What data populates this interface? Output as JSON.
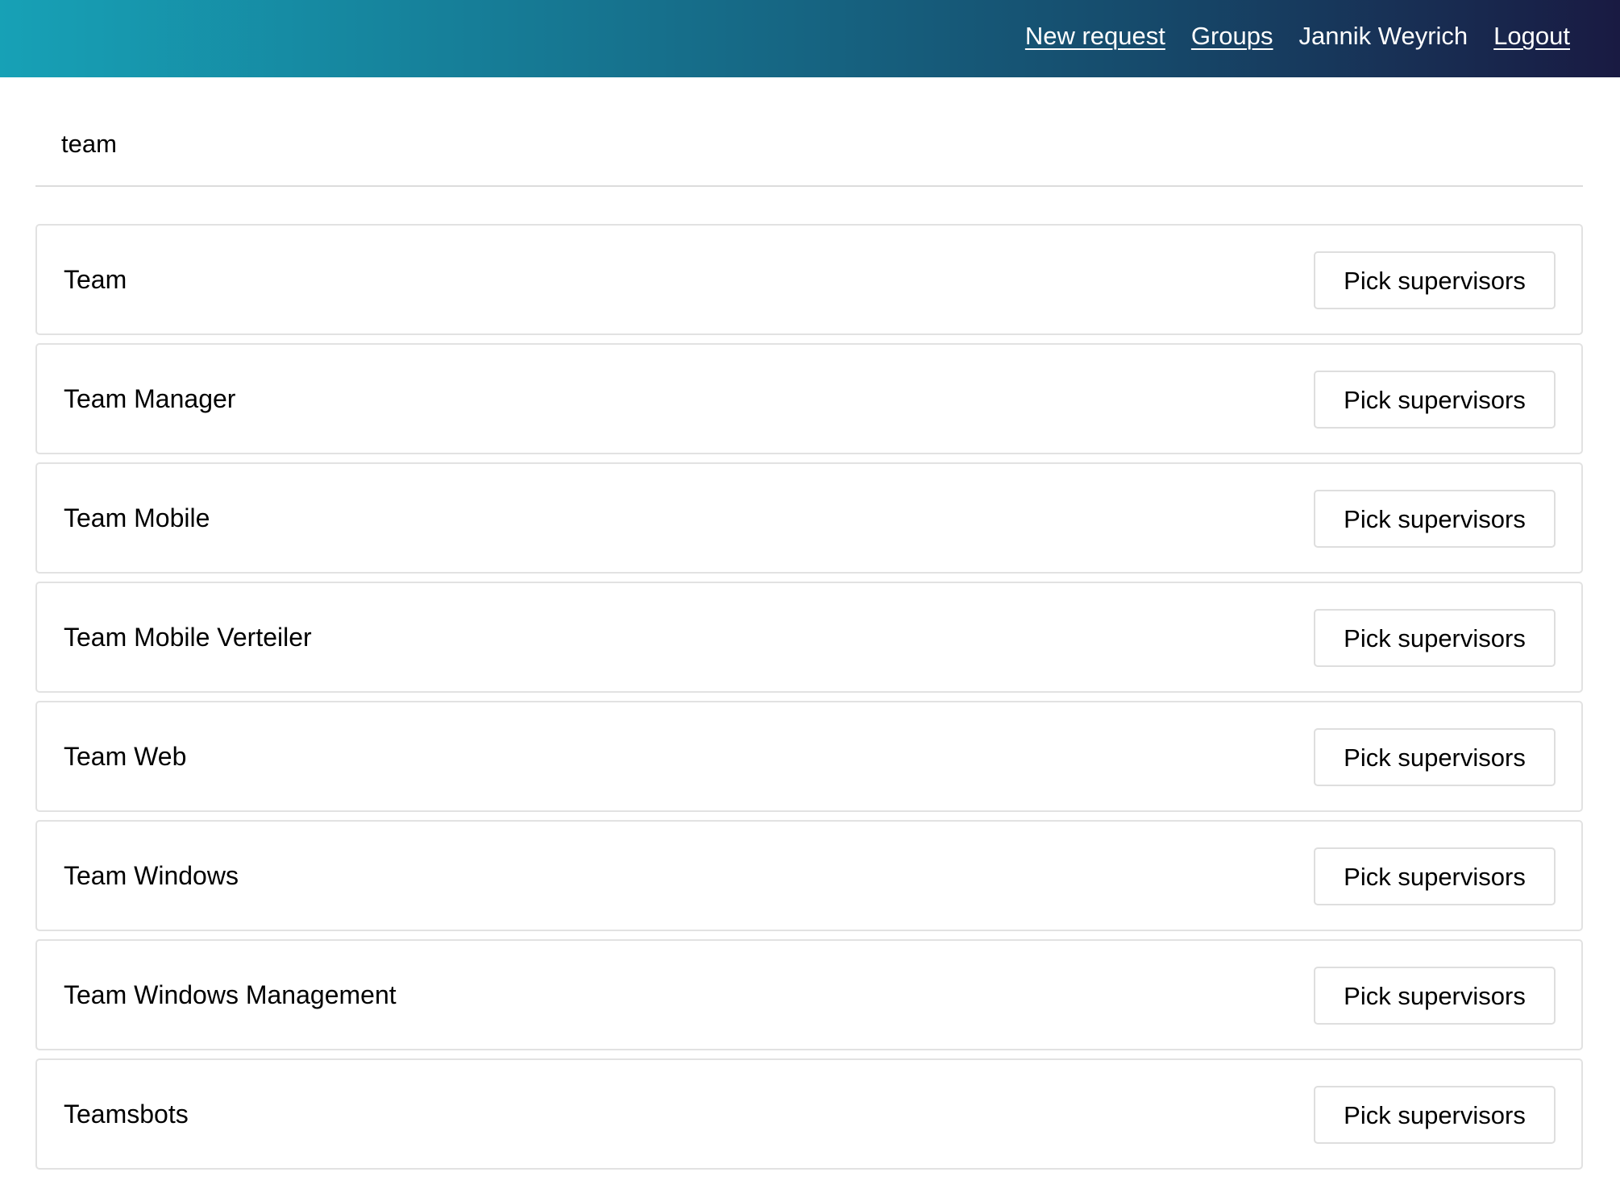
{
  "header": {
    "gradient_colors": [
      "#17a1b6",
      "#167792",
      "#164b6c",
      "#191a42"
    ],
    "nav": {
      "new_request": "New request",
      "groups": "Groups",
      "user_name": "Jannik Weyrich",
      "logout": "Logout"
    }
  },
  "search": {
    "value": "team"
  },
  "groups": [
    {
      "name": "Team",
      "action": "Pick supervisors"
    },
    {
      "name": "Team Manager",
      "action": "Pick supervisors"
    },
    {
      "name": "Team Mobile",
      "action": "Pick supervisors"
    },
    {
      "name": "Team Mobile Verteiler",
      "action": "Pick supervisors"
    },
    {
      "name": "Team Web",
      "action": "Pick supervisors"
    },
    {
      "name": "Team Windows",
      "action": "Pick supervisors"
    },
    {
      "name": "Team Windows Management",
      "action": "Pick supervisors"
    },
    {
      "name": "Teamsbots",
      "action": "Pick supervisors"
    }
  ]
}
